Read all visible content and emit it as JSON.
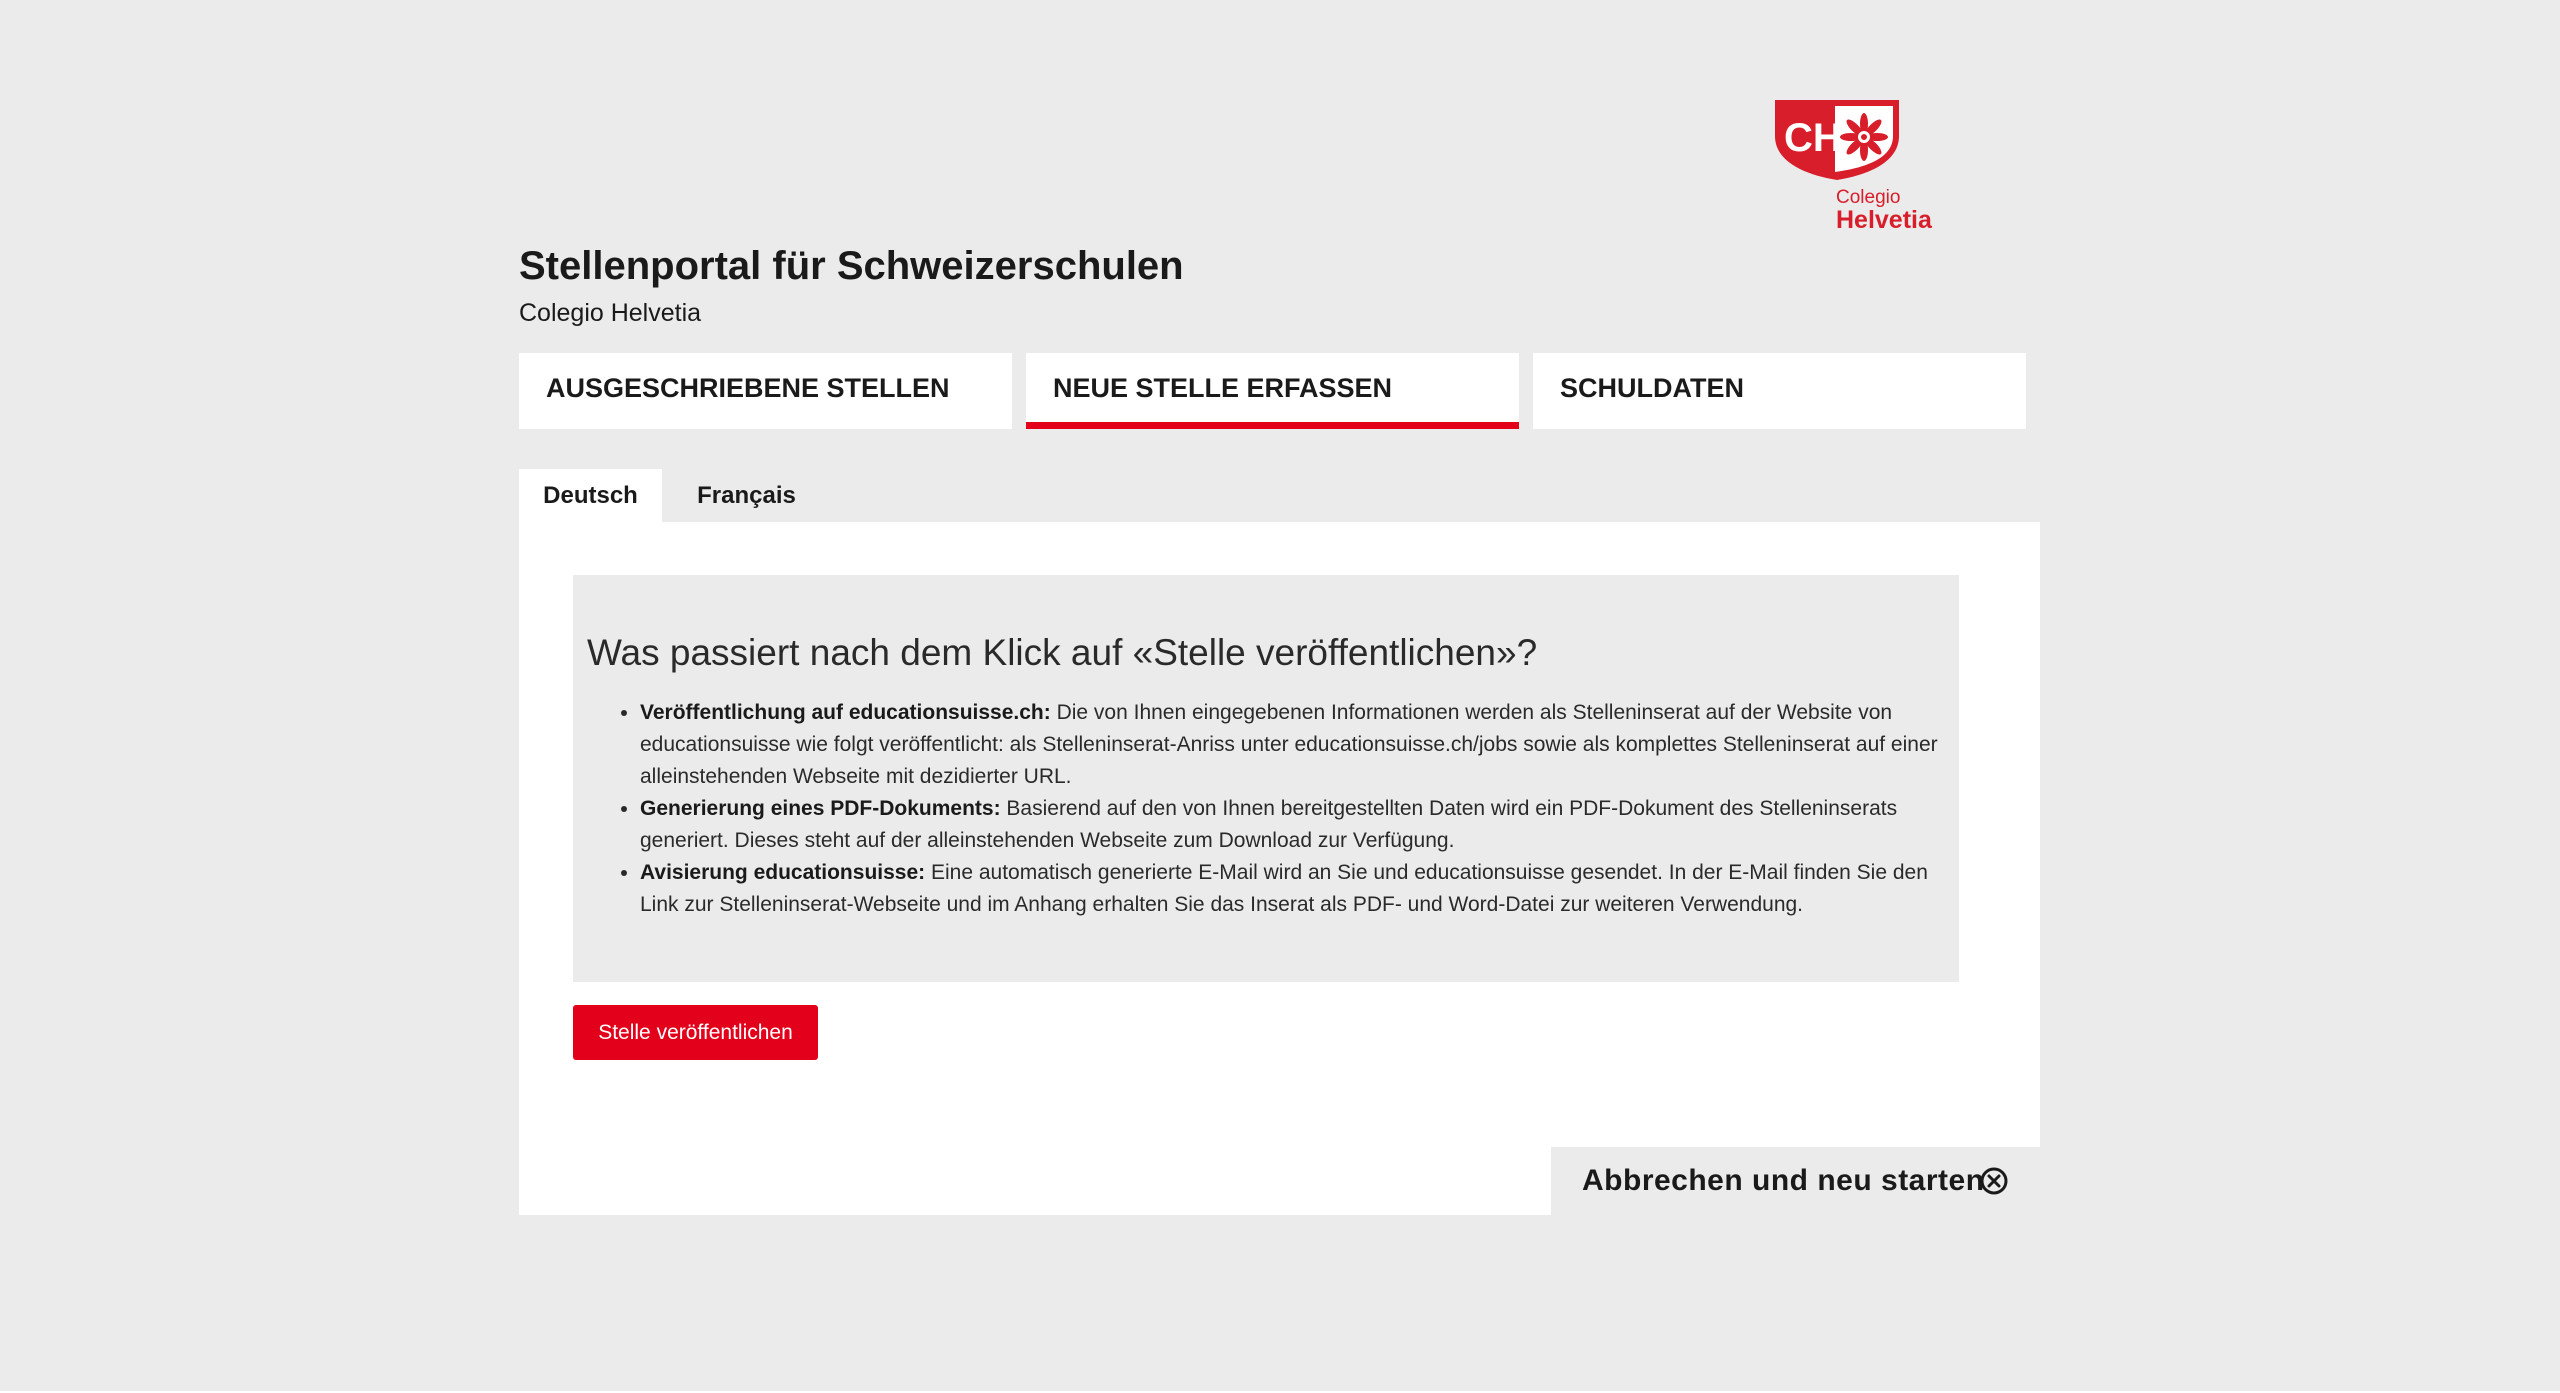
{
  "logo": {
    "mark": "CH",
    "sub": "Colegio",
    "main": "Helvetia",
    "icon": "edelweiss-shield-icon",
    "color": "#d81e2a"
  },
  "header": {
    "title": "Stellenportal für Schweizerschulen",
    "subtitle": "Colegio Helvetia"
  },
  "nav": {
    "items": [
      {
        "label": "AUSGESCHRIEBENE STELLEN",
        "active": false
      },
      {
        "label": "NEUE STELLE ERFASSEN",
        "active": true
      },
      {
        "label": "SCHULDATEN",
        "active": false
      }
    ],
    "accent_color": "#e2001a"
  },
  "language_tabs": [
    {
      "label": "Deutsch",
      "active": true
    },
    {
      "label": "Français",
      "active": false
    }
  ],
  "info": {
    "title": "Was passiert nach dem Klick auf «Stelle veröffentlichen»?",
    "items": [
      {
        "term": "Veröffentlichung auf educationsuisse.ch:",
        "text": " Die von Ihnen eingegebenen Informationen werden als Stelleninserat auf der Website von educationsuisse wie folgt veröffentlicht: als Stelleninserat-Anriss unter educationsuisse.ch/jobs sowie als komplettes Stelleninserat auf einer alleinstehenden Webseite mit dezidierter URL."
      },
      {
        "term": "Generierung eines PDF-Dokuments:",
        "text": " Basierend auf den von Ihnen bereitgestellten Daten wird ein PDF-Dokument des Stelleninserats generiert. Dieses steht auf der alleinstehenden Webseite zum Download zur Verfügung."
      },
      {
        "term": "Avisierung educationsuisse:",
        "text": " Eine automatisch generierte E-Mail wird an Sie und educationsuisse gesendet. In der E-Mail finden Sie den Link zur Stelleninserat-Webseite und im Anhang erhalten Sie das Inserat als PDF- und Word-Datei zur weiteren Verwendung."
      }
    ]
  },
  "actions": {
    "publish_label": "Stelle veröffentlichen",
    "cancel_label": "Abbrechen und neu starten",
    "cancel_icon": "close-circle-icon",
    "publish_color": "#e2001a"
  }
}
